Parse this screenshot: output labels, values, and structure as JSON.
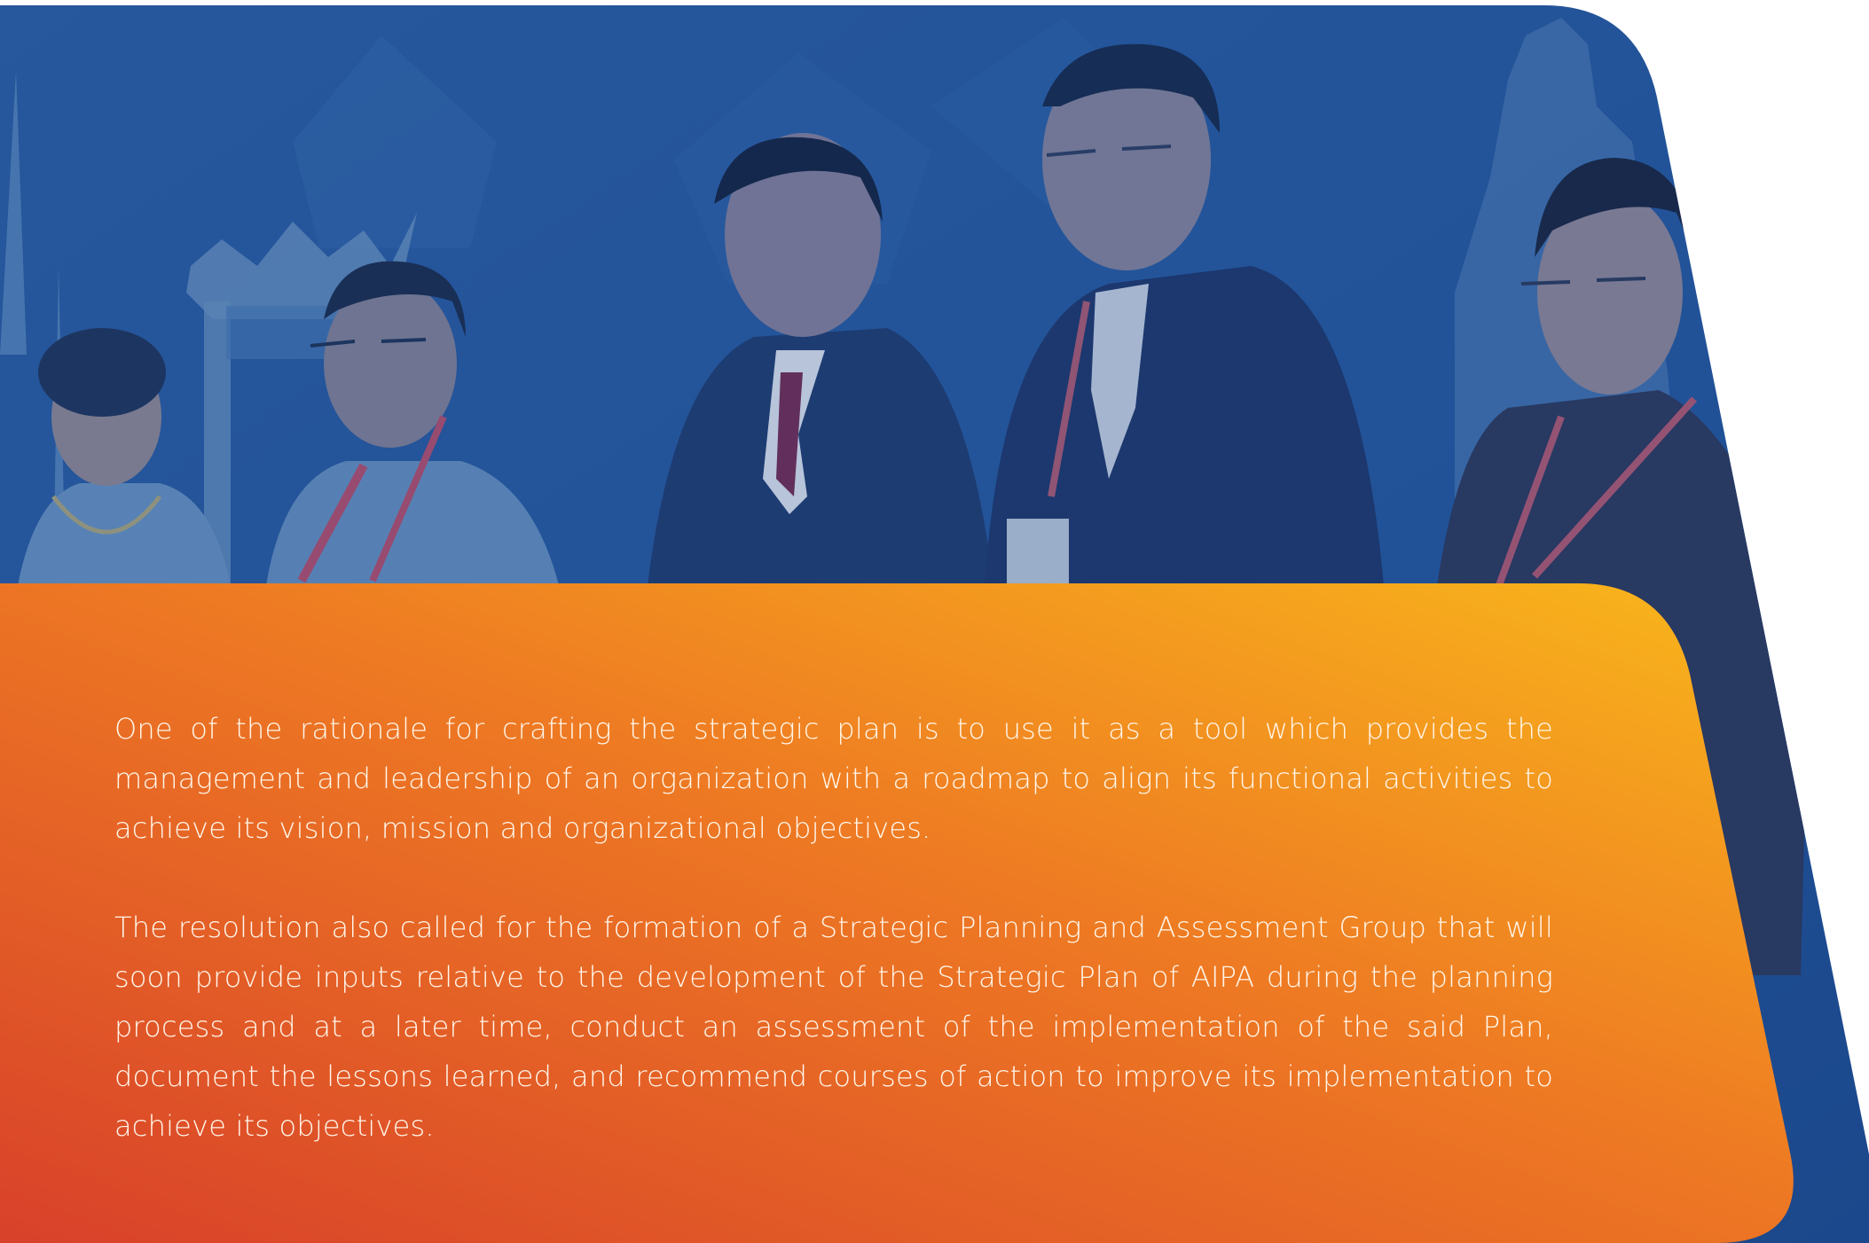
{
  "colors": {
    "photo_overlay": "#1f4f93",
    "photo_deep": "#1b3f7d",
    "card_gradient_start": "#d8412a",
    "card_gradient_mid": "#ee7a23",
    "card_gradient_end": "#f9b81b",
    "text": "#fff6ea"
  },
  "photo": {
    "subject": "delegates-standing-row",
    "icon": "group-photo-image"
  },
  "body": {
    "paragraph_1": "One of the rationale for crafting the strategic plan is to use it as a tool which provides the management and leadership of an organization with a roadmap to align its functional activities to achieve its vision, mission and organizational objectives.",
    "paragraph_2": "The resolution also called for the formation of a Strategic Planning and Assessment Group that will soon provide inputs relative to the development of the Strategic Plan of AIPA during the planning process and at a later time, conduct an assessment of the implementation of the said Plan, document the lessons learned, and recommend courses of action to improve its implementation to achieve its objectives."
  }
}
